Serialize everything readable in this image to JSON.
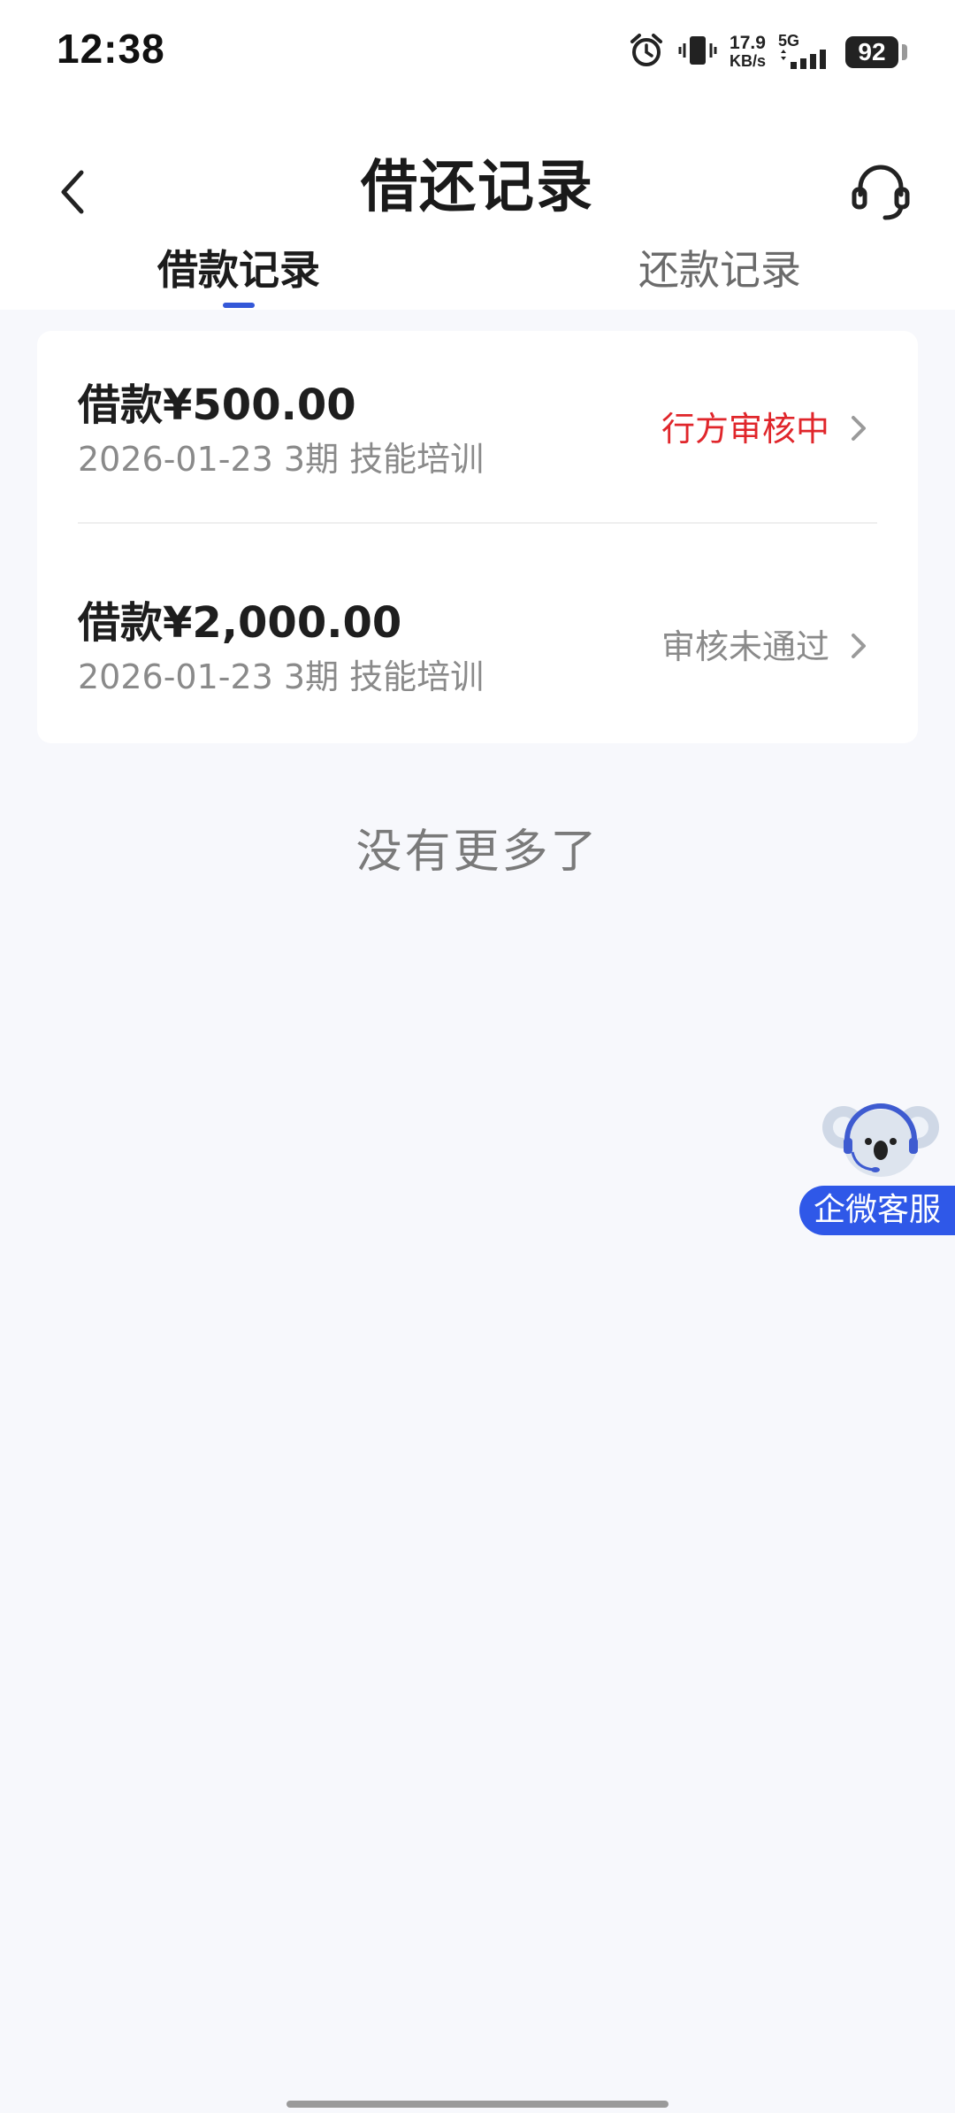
{
  "status_bar": {
    "time": "12:38",
    "net_speed_value": "17.9",
    "net_speed_unit": "KB/s",
    "network_type": "5G",
    "battery": "92",
    "icons": [
      "alarm-icon",
      "vibrate-icon",
      "signal-icon",
      "battery-icon"
    ]
  },
  "header": {
    "title": "借还记录",
    "back_icon": "chevron-left-icon",
    "service_icon": "headset-icon"
  },
  "tabs": [
    {
      "label": "借款记录",
      "active": true
    },
    {
      "label": "还款记录",
      "active": false
    }
  ],
  "records": [
    {
      "amount": "借款¥500.00",
      "meta": "2026-01-23 3期  技能培训",
      "status": "行方审核中",
      "status_color": "#e0262b"
    },
    {
      "amount": "借款¥2,000.00",
      "meta": "2026-01-23 3期  技能培训",
      "status": "审核未通过",
      "status_color": "#8a8a8a"
    }
  ],
  "footer_text": "没有更多了",
  "float_service": {
    "label": "企微客服",
    "icon": "koala-mascot-icon"
  },
  "colors": {
    "accent": "#3458d8",
    "background": "#f7f8fc",
    "pending_status": "#e0262b",
    "rejected_status": "#8a8a8a"
  }
}
